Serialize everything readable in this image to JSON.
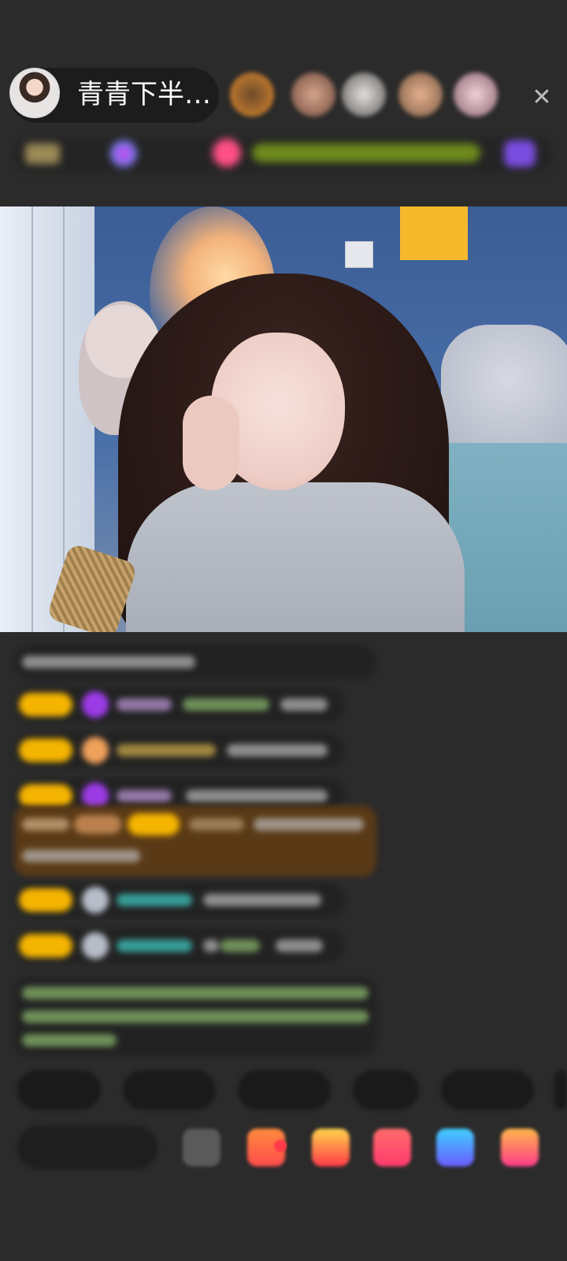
{
  "header": {
    "host_name": "青青下半…",
    "close_glyph": "✕"
  },
  "colors": {
    "background": "#2b2b2b",
    "badge_gold": "#f5b400",
    "notice_brown": "#5a3a16",
    "accent_purple": "#9b3be6",
    "accent_red": "#ff3b4a",
    "accent_pink": "#ff4f86",
    "accent_cyan": "#3ed0c9"
  },
  "icons": {
    "close": "close-icon",
    "emoji": "emoji-icon",
    "gift": "gift-icon",
    "more": "more-icon"
  }
}
